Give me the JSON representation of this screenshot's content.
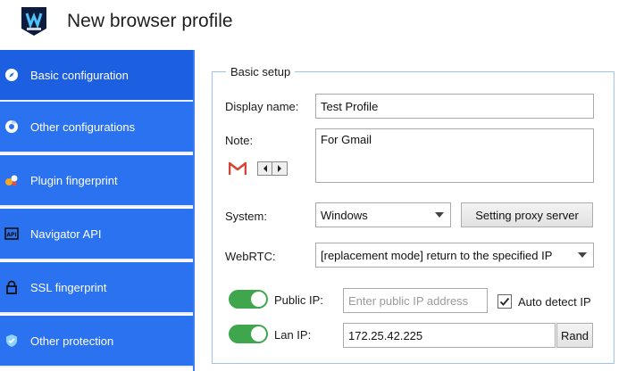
{
  "window": {
    "title": "New browser profile"
  },
  "sidebar": {
    "items": [
      {
        "label": "Basic configuration",
        "icon": "compass-icon",
        "active": true
      },
      {
        "label": "Other configurations",
        "icon": "chrome-icon",
        "active": false
      },
      {
        "label": "Plugin fingerprint",
        "icon": "puzzle-icon",
        "active": false
      },
      {
        "label": "Navigator API",
        "icon": "api-icon",
        "active": false
      },
      {
        "label": "SSL fingerprint",
        "icon": "lock-icon",
        "active": false
      },
      {
        "label": "Other protection",
        "icon": "shield-icon",
        "active": false
      }
    ]
  },
  "basic_setup": {
    "legend": "Basic setup",
    "display_name_label": "Display name:",
    "display_name_value": "Test Profile",
    "note_label": "Note:",
    "note_value": "For Gmail",
    "system_label": "System:",
    "system_value": "Windows",
    "proxy_button": "Setting proxy server",
    "webrtc_label": "WebRTC:",
    "webrtc_value": "[replacement mode] return to the specified IP",
    "public_ip_label": "Public IP:",
    "public_ip_placeholder": "Enter public IP address",
    "public_ip_toggle_on": true,
    "auto_detect_label": "Auto detect IP",
    "auto_detect_checked": true,
    "lan_ip_label": "Lan IP:",
    "lan_ip_value": "172.25.42.225",
    "lan_ip_toggle_on": true,
    "rand_button": "Rand"
  },
  "colors": {
    "sidebar_bg": "#2a72ef",
    "toggle_on": "#3fa64e",
    "group_border": "#9cc3ea"
  }
}
